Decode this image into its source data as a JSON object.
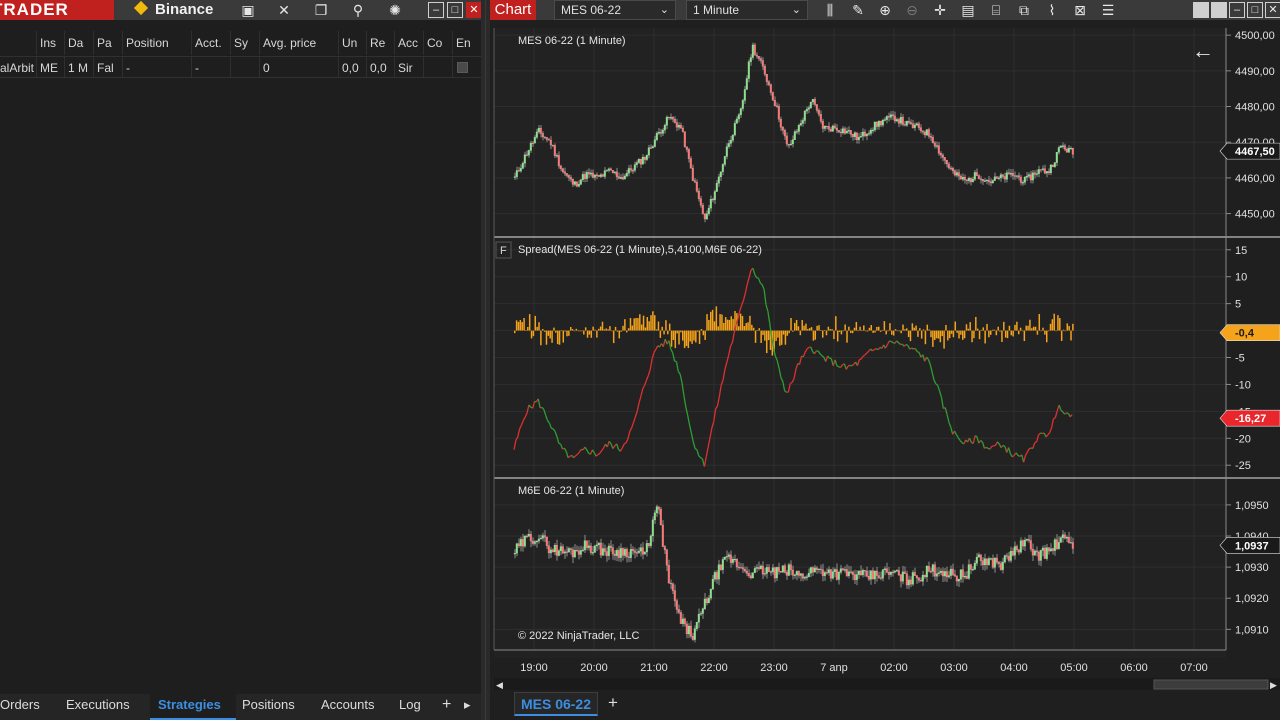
{
  "control_center": {
    "logo": "TRADER",
    "connection": "Binance",
    "grid": {
      "columns": [
        "Ins",
        "Da",
        "Pa",
        "Position",
        "Acct.",
        "Sy",
        "Avg. price",
        "Un",
        "Re",
        "Acc",
        "Co",
        "En"
      ],
      "row": [
        "alArbit",
        "ME",
        "1 M",
        "Fal",
        "-",
        "-",
        "",
        "0",
        "0,0",
        "0,0",
        "Sir",
        "",
        ""
      ]
    },
    "tabs": [
      "Orders",
      "Executions",
      "Strategies",
      "Positions",
      "Accounts",
      "Log"
    ],
    "active_tab": "Strategies",
    "tab_add": "+",
    "tab_next": "▸"
  },
  "chart_window": {
    "tab_label": "Chart",
    "instrument": "MES 06-22",
    "interval": "1 Minute",
    "bottom_tab": "MES 06-22",
    "bottom_add": "+",
    "copyright": "© 2022 NinjaTrader, LLC",
    "back_arrow": "←"
  },
  "chart_data": [
    {
      "type": "candlestick",
      "title": "MES 06-22 (1 Minute)",
      "y_ticks": [
        "4500,00",
        "4490,00",
        "4480,00",
        "4470,00",
        "4460,00",
        "4450,00"
      ],
      "ylim": [
        4444,
        4502
      ],
      "last_price_label": "4467,50",
      "last_price": 4467.5,
      "x_ticks": [
        "19:00",
        "20:00",
        "21:00",
        "22:00",
        "23:00",
        "7 anp",
        "02:00",
        "03:00",
        "04:00",
        "05:00",
        "06:00",
        "07:00"
      ],
      "close_trace": [
        4460,
        4467,
        4473,
        4470,
        4462,
        4458,
        4461,
        4460,
        4462,
        4460,
        4463,
        4466,
        4472,
        4477,
        4474,
        4460,
        4448,
        4458,
        4470,
        4478,
        4497,
        4490,
        4480,
        4468,
        4475,
        4482,
        4474,
        4474,
        4473,
        4471,
        4474,
        4476,
        4477,
        4475,
        4474,
        4472,
        4466,
        4461,
        4459,
        4461,
        4459,
        4460,
        4461,
        4459,
        4462,
        4462,
        4469,
        4467
      ]
    },
    {
      "type": "histogram+line",
      "title": "Spread(MES 06-22 (1 Minute),5,4100,M6E 06-22)",
      "panel_flag": "F",
      "y_ticks": [
        "15",
        "10",
        "5",
        "0",
        "-5",
        "-10",
        "-15",
        "-20",
        "-25"
      ],
      "ylim": [
        -27,
        17
      ],
      "histogram_last_label": "-0,4",
      "line_last_label": "-16,27",
      "line_trace": [
        -22,
        -15,
        -13,
        -17,
        -22,
        -24,
        -22,
        -23,
        -21,
        -22,
        -18,
        -10,
        -3,
        -2,
        -8,
        -20,
        -25,
        -15,
        -5,
        3,
        12,
        8,
        -5,
        -12,
        -6,
        -3,
        -5,
        -6,
        -7,
        -6,
        -4,
        -3,
        -2,
        -3,
        -4,
        -6,
        -13,
        -19,
        -21,
        -20,
        -22,
        -21,
        -23,
        -24,
        -20,
        -19,
        -14,
        -16.27
      ],
      "histogram_colors": {
        "bar": "#f5a31a",
        "line_up": "#e03030",
        "line_down": "#2e9e34"
      }
    },
    {
      "type": "candlestick",
      "title": "M6E 06-22 (1 Minute)",
      "y_ticks": [
        "1,0950",
        "1,0940",
        "1,0930",
        "1,0920",
        "1,0910"
      ],
      "ylim": [
        1.0904,
        1.0958
      ],
      "last_price_label": "1,0937",
      "last_price": 1.0937,
      "close_trace": [
        1.0935,
        1.0939,
        1.094,
        1.0936,
        1.0935,
        1.0935,
        1.0937,
        1.0936,
        1.0935,
        1.0935,
        1.0935,
        1.0934,
        1.095,
        1.0925,
        1.0912,
        1.0908,
        1.0918,
        1.0928,
        1.0933,
        1.093,
        1.0928,
        1.0929,
        1.0928,
        1.0929,
        1.0927,
        1.0929,
        1.0929,
        1.0928,
        1.0928,
        1.0927,
        1.0927,
        1.0928,
        1.0928,
        1.0926,
        1.0927,
        1.0929,
        1.0929,
        1.0927,
        1.0928,
        1.0932,
        1.0932,
        1.0931,
        1.0935,
        1.0938,
        1.0934,
        1.0935,
        1.0939,
        1.0937
      ]
    }
  ]
}
